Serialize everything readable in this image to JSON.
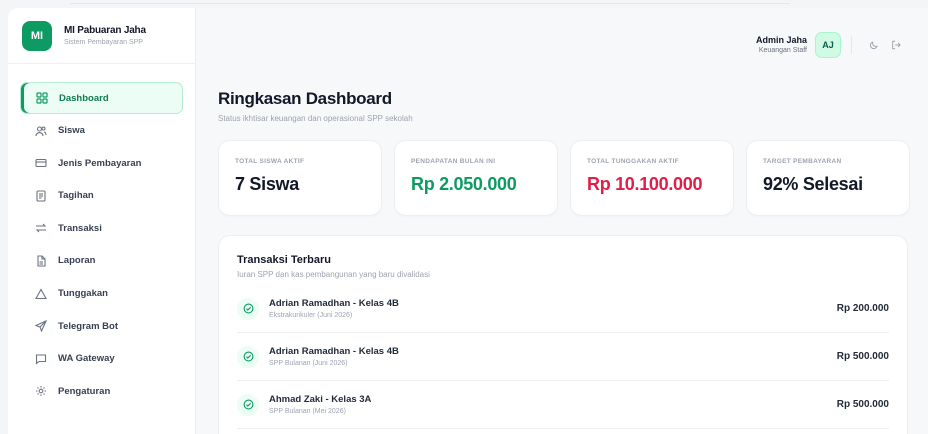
{
  "brand": {
    "logo": "MI",
    "title": "MI Pabuaran Jaha",
    "subtitle": "Sistem Pembayaran SPP"
  },
  "sidebar": {
    "items": [
      {
        "label": "Dashboard",
        "icon": "grid-icon",
        "active": true
      },
      {
        "label": "Siswa",
        "icon": "users-icon"
      },
      {
        "label": "Jenis Pembayaran",
        "icon": "credit-card-icon"
      },
      {
        "label": "Tagihan",
        "icon": "receipt-icon"
      },
      {
        "label": "Transaksi",
        "icon": "swap-icon"
      },
      {
        "label": "Laporan",
        "icon": "file-icon"
      },
      {
        "label": "Tunggakan",
        "icon": "warning-icon"
      },
      {
        "label": "Telegram Bot",
        "icon": "send-icon"
      },
      {
        "label": "WA Gateway",
        "icon": "chat-icon"
      },
      {
        "label": "Pengaturan",
        "icon": "gear-icon"
      }
    ]
  },
  "topbar": {
    "user_name": "Admin Jaha",
    "user_role": "Keuangan Staff",
    "avatar": "AJ"
  },
  "header": {
    "title": "Ringkasan Dashboard",
    "subtitle": "Status ikhtisar keuangan dan operasional SPP sekolah"
  },
  "stats": [
    {
      "label": "TOTAL SISWA AKTIF",
      "value": "7 Siswa",
      "color": "#111827"
    },
    {
      "label": "PENDAPATAN BULAN INI",
      "value": "Rp 2.050.000",
      "color": "#0e9a63"
    },
    {
      "label": "TOTAL TUNGGAKAN AKTIF",
      "value": "Rp 10.100.000",
      "color": "#e11d48"
    },
    {
      "label": "TARGET PEMBAYARAN",
      "value": "92% Selesai",
      "color": "#111827"
    }
  ],
  "transactions": {
    "title": "Transaksi Terbaru",
    "subtitle": "Iuran SPP dan kas pembangunan yang baru divalidasi",
    "items": [
      {
        "name": "Adrian Ramadhan - Kelas 4B",
        "desc": "Ekstrakurikuler (Juni 2026)",
        "amount": "Rp 200.000"
      },
      {
        "name": "Adrian Ramadhan - Kelas 4B",
        "desc": "SPP Bulanan (Juni 2026)",
        "amount": "Rp 500.000"
      },
      {
        "name": "Ahmad Zaki - Kelas 3A",
        "desc": "SPP Bulanan (Mei 2026)",
        "amount": "Rp 500.000"
      }
    ]
  }
}
